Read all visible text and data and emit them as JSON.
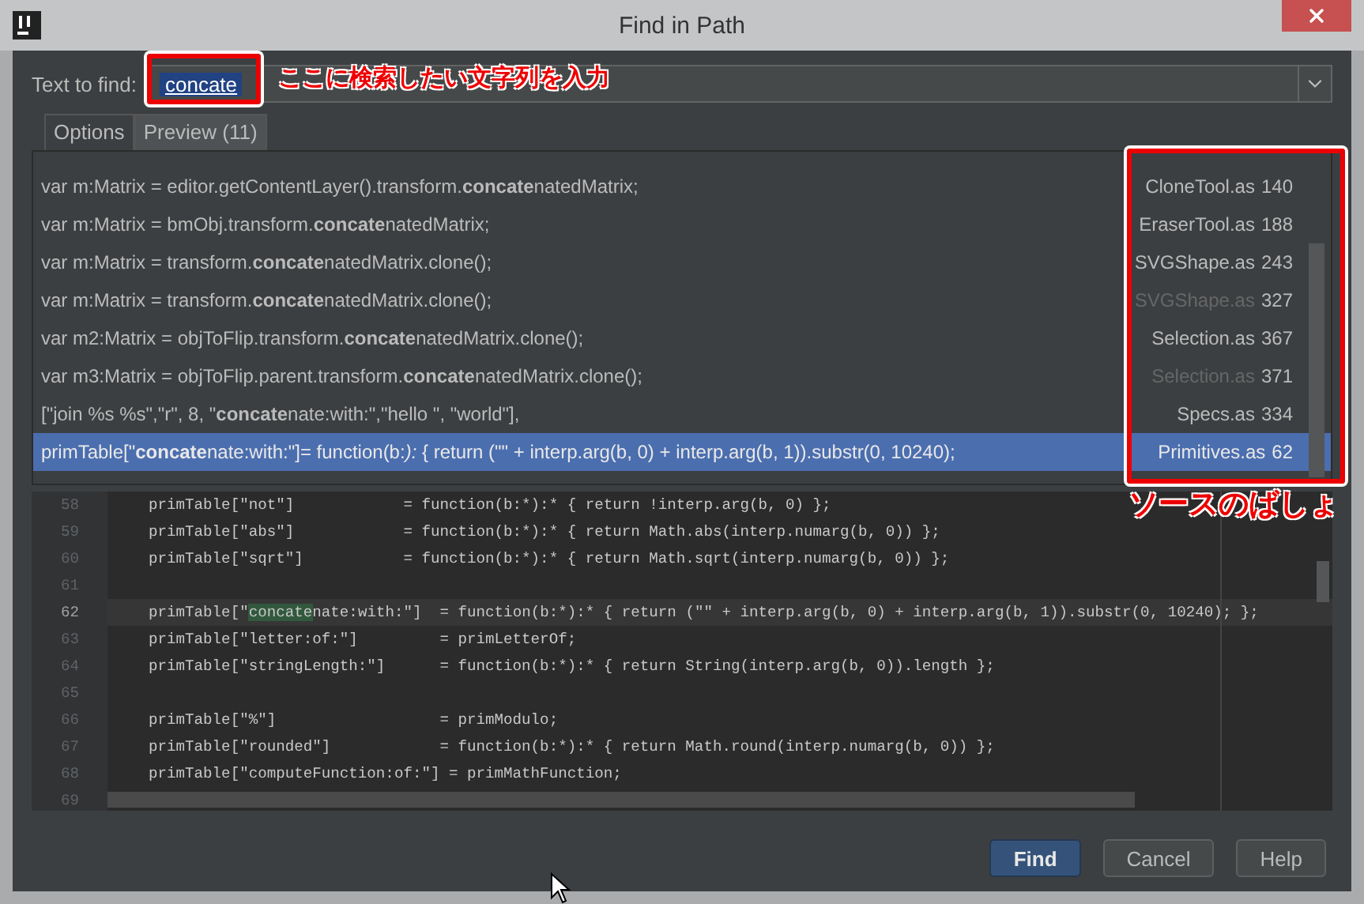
{
  "window": {
    "title": "Find in Path"
  },
  "search": {
    "label": "Text to find:",
    "value": "concate"
  },
  "tabs": [
    {
      "label": "Options",
      "selected": false
    },
    {
      "label": "Preview (11)",
      "selected": true
    }
  ],
  "results": [
    {
      "text": "var m:Matrix = editor.getContentLayer().transform.**concate**natedMatrix;",
      "file": "CloneTool.as",
      "line": "140",
      "dimmed": false,
      "selected": false
    },
    {
      "text": "var m:Matrix = bmObj.transform.**concate**natedMatrix;",
      "file": "EraserTool.as",
      "line": "188",
      "dimmed": false,
      "selected": false
    },
    {
      "text": "var m:Matrix = transform.**concate**natedMatrix.clone();",
      "file": "SVGShape.as",
      "line": "243",
      "dimmed": false,
      "selected": false
    },
    {
      "text": "var m:Matrix = transform.**concate**natedMatrix.clone();",
      "file": "SVGShape.as",
      "line": "327",
      "dimmed": true,
      "selected": false
    },
    {
      "text": "var m2:Matrix = objToFlip.transform.**concate**natedMatrix.clone();",
      "file": "Selection.as",
      "line": "367",
      "dimmed": false,
      "selected": false
    },
    {
      "text": "var m3:Matrix = objToFlip.parent.transform.**concate**natedMatrix.clone();",
      "file": "Selection.as",
      "line": "371",
      "dimmed": true,
      "selected": false
    },
    {
      "text": "[\"join %s %s\",\"r\", 8, \"**concate**nate:with:\",\"hello \", \"world\"],",
      "file": "Specs.as",
      "line": "334",
      "dimmed": false,
      "selected": false
    },
    {
      "text": "primTable[\"**concate**nate:with:\"]= function(b:*):* { return (\"\" + interp.arg(b, 0) + interp.arg(b, 1)).substr(0, 10240);",
      "file": "Primitives.as",
      "line": "62",
      "dimmed": false,
      "selected": true
    }
  ],
  "code": [
    {
      "number": "58",
      "before": "primTable[\"not\"]            = function(b:*):* { return !interp.arg(b, 0) };",
      "current": false
    },
    {
      "number": "59",
      "before": "primTable[\"abs\"]            = function(b:*):* { return Math.abs(interp.numarg(b, 0)) };",
      "current": false
    },
    {
      "number": "60",
      "before": "primTable[\"sqrt\"]           = function(b:*):* { return Math.sqrt(interp.numarg(b, 0)) };",
      "current": false
    },
    {
      "number": "61",
      "current": false
    },
    {
      "number": "62",
      "before": "primTable[\"",
      "match": "concate",
      "after": "nate:with:\"]  = function(b:*):* { return (\"\" + interp.arg(b, 0) + interp.arg(b, 1)).substr(0, 10240); };",
      "current": true
    },
    {
      "number": "63",
      "before": "primTable[\"letter:of:\"]         = primLetterOf;",
      "current": false
    },
    {
      "number": "64",
      "before": "primTable[\"stringLength:\"]      = function(b:*):* { return String(interp.arg(b, 0)).length };",
      "current": false
    },
    {
      "number": "65",
      "current": false
    },
    {
      "number": "66",
      "before": "primTable[\"%\"]                  = primModulo;",
      "current": false
    },
    {
      "number": "67",
      "before": "primTable[\"rounded\"]            = function(b:*):* { return Math.round(interp.numarg(b, 0)) };",
      "current": false
    },
    {
      "number": "68",
      "before": "primTable[\"computeFunction:of:\"] = primMathFunction;",
      "current": false
    },
    {
      "number": "69",
      "current": false
    }
  ],
  "buttons": [
    {
      "label": "Find",
      "kind": "primary"
    },
    {
      "label": "Cancel",
      "kind": "normal"
    },
    {
      "label": "Help",
      "kind": "normal"
    }
  ],
  "annotations": [
    {
      "text": "ここに検索したい文字列を入力"
    },
    {
      "text": "ソースのばしょ"
    }
  ]
}
